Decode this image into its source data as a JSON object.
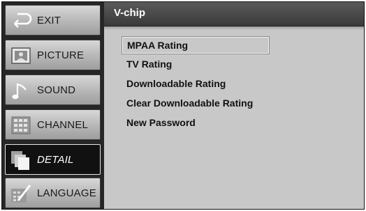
{
  "sidebar": {
    "items": [
      {
        "label": "EXIT",
        "icon": "exit-arrow-icon",
        "active": false
      },
      {
        "label": "PICTURE",
        "icon": "picture-icon",
        "active": false
      },
      {
        "label": "SOUND",
        "icon": "sound-note-icon",
        "active": false
      },
      {
        "label": "CHANNEL",
        "icon": "channel-grid-icon",
        "active": false
      },
      {
        "label": "DETAIL",
        "icon": "detail-pages-icon",
        "active": true
      },
      {
        "label": "LANGUAGE",
        "icon": "language-pencil-icon",
        "active": false
      }
    ]
  },
  "main": {
    "title": "V-chip",
    "menu": [
      {
        "label": "MPAA Rating",
        "selected": true
      },
      {
        "label": "TV Rating",
        "selected": false
      },
      {
        "label": "Downloadable Rating",
        "selected": false
      },
      {
        "label": "Clear Downloadable Rating",
        "selected": false
      },
      {
        "label": "New Password",
        "selected": false
      }
    ]
  },
  "colors": {
    "sidebar_button": "#c4c4c4",
    "active_button": "#111111",
    "panel_background": "#c8c8c8",
    "title_bar": "#444444"
  }
}
